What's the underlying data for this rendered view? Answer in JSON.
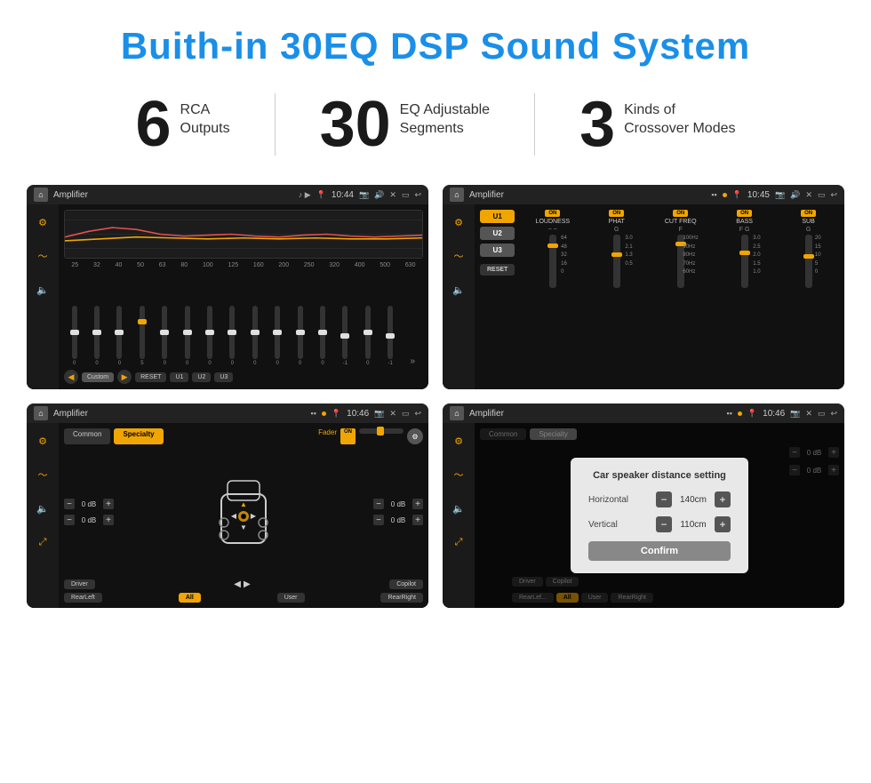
{
  "page": {
    "title": "Buith-in 30EQ DSP Sound System"
  },
  "stats": [
    {
      "number": "6",
      "line1": "RCA",
      "line2": "Outputs"
    },
    {
      "number": "30",
      "line1": "EQ Adjustable",
      "line2": "Segments"
    },
    {
      "number": "3",
      "line1": "Kinds of",
      "line2": "Crossover Modes"
    }
  ],
  "screens": [
    {
      "id": "screen1",
      "time": "10:44",
      "title": "Amplifier",
      "eq_labels": [
        "25",
        "32",
        "40",
        "50",
        "63",
        "80",
        "100",
        "125",
        "160",
        "200",
        "250",
        "320",
        "400",
        "500",
        "630"
      ],
      "eq_values": [
        "0",
        "0",
        "0",
        "5",
        "0",
        "0",
        "0",
        "0",
        "0",
        "0",
        "0",
        "0",
        "-1",
        "0",
        "-1"
      ],
      "bottom_btns": [
        "Custom",
        "RESET",
        "U1",
        "U2",
        "U3"
      ]
    },
    {
      "id": "screen2",
      "time": "10:45",
      "title": "Amplifier",
      "presets": [
        "U1",
        "U2",
        "U3"
      ],
      "bands": [
        "LOUDNESS",
        "PHAT",
        "CUT FREQ",
        "BASS",
        "SUB"
      ],
      "on_labels": [
        "ON",
        "ON",
        "ON",
        "ON",
        "ON"
      ]
    },
    {
      "id": "screen3",
      "time": "10:46",
      "title": "Amplifier",
      "tabs": [
        "Common",
        "Specialty"
      ],
      "fader_label": "Fader",
      "fader_on": "ON",
      "volume_labels": [
        "0 dB",
        "0 dB",
        "0 dB",
        "0 dB"
      ],
      "bottom_btns": [
        "Driver",
        "",
        "",
        "Copilot",
        "RearLeft",
        "All",
        "User",
        "RearRight"
      ]
    },
    {
      "id": "screen4",
      "time": "10:46",
      "title": "Amplifier",
      "tabs": [
        "Common",
        "Specialty"
      ],
      "dialog": {
        "title": "Car speaker distance setting",
        "horizontal_label": "Horizontal",
        "horizontal_value": "140cm",
        "vertical_label": "Vertical",
        "vertical_value": "110cm",
        "confirm_label": "Confirm"
      },
      "right_labels": [
        "0 dB",
        "0 dB"
      ],
      "bottom_btns": [
        "Driver",
        "Copilot",
        "RearLef...",
        "User",
        "RearRight"
      ]
    }
  ]
}
